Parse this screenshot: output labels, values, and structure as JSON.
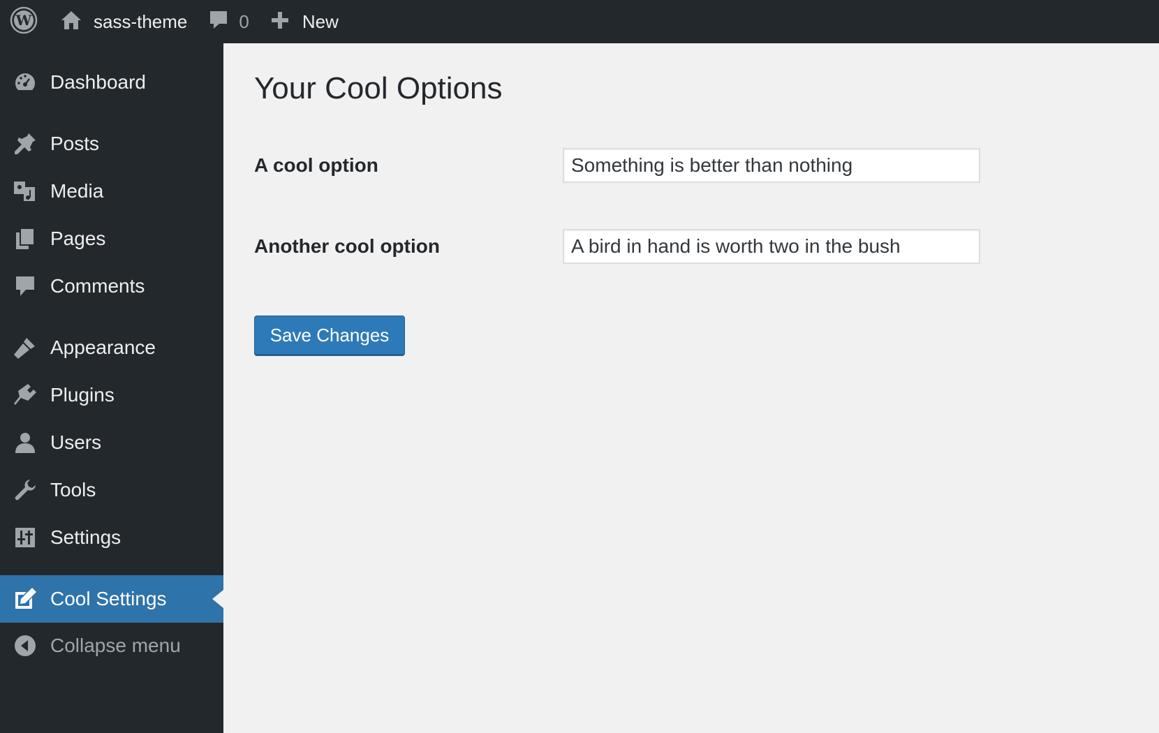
{
  "admin_bar": {
    "site_name": "sass-theme",
    "comments_count": "0",
    "new_label": "New"
  },
  "sidebar": {
    "items": [
      {
        "label": "Dashboard",
        "icon": "dashboard-icon"
      },
      {
        "label": "Posts",
        "icon": "pin-icon"
      },
      {
        "label": "Media",
        "icon": "media-icon"
      },
      {
        "label": "Pages",
        "icon": "pages-icon"
      },
      {
        "label": "Comments",
        "icon": "comment-icon"
      },
      {
        "label": "Appearance",
        "icon": "brush-icon"
      },
      {
        "label": "Plugins",
        "icon": "plugin-icon"
      },
      {
        "label": "Users",
        "icon": "user-icon"
      },
      {
        "label": "Tools",
        "icon": "wrench-icon"
      },
      {
        "label": "Settings",
        "icon": "sliders-icon"
      },
      {
        "label": "Cool Settings",
        "icon": "edit-icon",
        "current": true
      },
      {
        "label": "Collapse menu",
        "icon": "collapse-icon"
      }
    ]
  },
  "main": {
    "title": "Your Cool Options",
    "fields": [
      {
        "label": "A cool option",
        "value": "Something is better than nothing"
      },
      {
        "label": "Another cool option",
        "value": "A bird in hand is worth two in the bush"
      }
    ],
    "save_label": "Save Changes"
  },
  "colors": {
    "admin_bg": "#23282d",
    "content_bg": "#f1f1f1",
    "accent": "#2e73aa",
    "button": "#2e7ab8"
  }
}
